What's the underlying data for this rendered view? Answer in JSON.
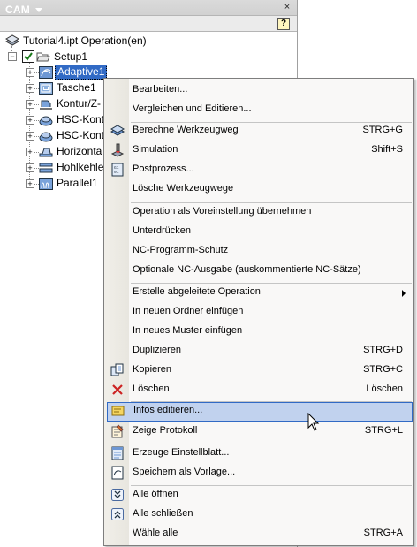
{
  "panel": {
    "title": "CAM",
    "help_glyph": "?",
    "close_glyph": "×"
  },
  "tree": {
    "root_label": "Tutorial4.ipt Operation(en)",
    "setup_label": "Setup1",
    "setup_checked": true,
    "operations": [
      {
        "label": "Adaptive1",
        "icon": "adaptive-op-icon",
        "selected": true
      },
      {
        "label": "Tasche1",
        "icon": "pocket-op-icon"
      },
      {
        "label": "Kontur/Z-",
        "icon": "contour-op-icon"
      },
      {
        "label": "HSC-Kont",
        "icon": "hsc-contour-op-icon"
      },
      {
        "label": "HSC-Kont",
        "icon": "hsc-contour-op-icon"
      },
      {
        "label": "Horizonta",
        "icon": "horizontal-op-icon"
      },
      {
        "label": "Hohlkehle",
        "icon": "fillet-op-icon"
      },
      {
        "label": "Parallel1",
        "icon": "parallel-op-icon"
      }
    ]
  },
  "menu": {
    "items": [
      {
        "label": "Bearbeiten...",
        "shortcut": "",
        "icon": ""
      },
      {
        "label": "Vergleichen und Editieren...",
        "shortcut": "",
        "icon": ""
      },
      {
        "label": "Berechne Werkzeugweg",
        "shortcut": "STRG+G",
        "icon": "generate-toolpath-icon"
      },
      {
        "label": "Simulation",
        "shortcut": "Shift+S",
        "icon": "simulation-icon"
      },
      {
        "label": "Postprozess...",
        "shortcut": "",
        "icon": "post-process-icon"
      },
      {
        "label": "Lösche Werkzeugwege",
        "shortcut": "",
        "icon": ""
      },
      {
        "label": "Operation als Voreinstellung übernehmen",
        "shortcut": "",
        "icon": ""
      },
      {
        "label": "Unterdrücken",
        "shortcut": "",
        "icon": ""
      },
      {
        "label": "NC-Programm-Schutz",
        "shortcut": "",
        "icon": ""
      },
      {
        "label": "Optionale NC-Ausgabe (auskommentierte NC-Sätze)",
        "shortcut": "",
        "icon": ""
      },
      {
        "label": "Erstelle abgeleitete Operation",
        "shortcut": "",
        "icon": "",
        "submenu": true
      },
      {
        "label": "In neuen Ordner einfügen",
        "shortcut": "",
        "icon": ""
      },
      {
        "label": "In neues Muster einfügen",
        "shortcut": "",
        "icon": ""
      },
      {
        "label": "Duplizieren",
        "shortcut": "STRG+D",
        "icon": ""
      },
      {
        "label": "Kopieren",
        "shortcut": "STRG+C",
        "icon": "copy-icon"
      },
      {
        "label": "Löschen",
        "shortcut": "Löschen",
        "icon": "delete-icon"
      },
      {
        "label": "Infos editieren...",
        "shortcut": "",
        "icon": "edit-notes-icon",
        "highlighted": true
      },
      {
        "label": "Zeige Protokoll",
        "shortcut": "STRG+L",
        "icon": "show-log-icon"
      },
      {
        "label": "Erzeuge Einstellblatt...",
        "shortcut": "",
        "icon": "setup-sheet-icon"
      },
      {
        "label": "Speichern als Vorlage...",
        "shortcut": "",
        "icon": "save-template-icon"
      },
      {
        "label": "Alle öffnen",
        "shortcut": "",
        "icon": "expand-all-icon"
      },
      {
        "label": "Alle schließen",
        "shortcut": "",
        "icon": "collapse-all-icon"
      },
      {
        "label": "Wähle alle",
        "shortcut": "STRG+A",
        "icon": ""
      }
    ]
  },
  "colors": {
    "selection": "#316ac5",
    "menu_highlight": "#c1d2ee",
    "delete_red": "#cc2222"
  }
}
